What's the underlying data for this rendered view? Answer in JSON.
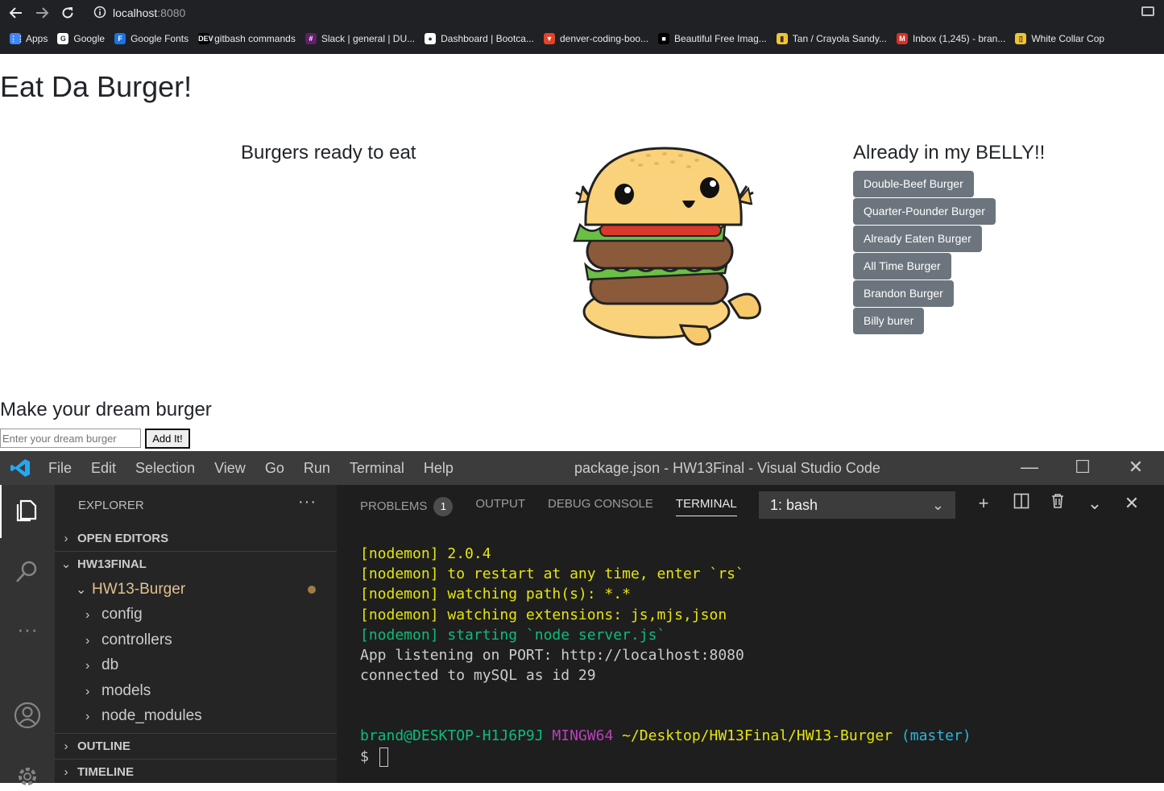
{
  "browser": {
    "url_host": "localhost",
    "url_port": ":8080",
    "bookmarks": [
      {
        "label": "Apps",
        "color": "#4285f4",
        "icon": "apps-grid-icon",
        "glyph": "⋮⋮"
      },
      {
        "label": "Google",
        "color": "#ffffff",
        "icon": "google-icon",
        "glyph": "G"
      },
      {
        "label": "Google Fonts",
        "color": "#1a73e8",
        "icon": "google-fonts-icon",
        "glyph": "F"
      },
      {
        "label": "gitbash commands",
        "color": "#000000",
        "icon": "dev-icon",
        "glyph": "DEV"
      },
      {
        "label": "Slack | general | DU...",
        "color": "#611f69",
        "icon": "slack-icon",
        "glyph": "#"
      },
      {
        "label": "Dashboard | Bootca...",
        "color": "#ffffff",
        "icon": "dashboard-icon",
        "glyph": "●"
      },
      {
        "label": "denver-coding-boo...",
        "color": "#e24329",
        "icon": "gitlab-icon",
        "glyph": "▼"
      },
      {
        "label": "Beautiful Free Imag...",
        "color": "#000000",
        "icon": "unsplash-icon",
        "glyph": "■"
      },
      {
        "label": "Tan / Crayola Sandy...",
        "color": "#f4c430",
        "icon": "crayola-icon",
        "glyph": "▮"
      },
      {
        "label": "Inbox (1,245) - bran...",
        "color": "#d93025",
        "icon": "gmail-icon",
        "glyph": "M"
      },
      {
        "label": "White Collar Cop",
        "color": "#f1c232",
        "icon": "doc-icon",
        "glyph": "▯"
      }
    ]
  },
  "page": {
    "title": "Eat Da Burger!",
    "ready_title": "Burgers ready to eat",
    "belly_title": "Already in my BELLY!!",
    "eaten_burgers": [
      "Double-Beef Burger",
      "Quarter-Pounder Burger",
      "Already Eaten Burger",
      "All Time Burger",
      "Brandon Burger",
      "Billy burer"
    ],
    "make_title": "Make your dream burger",
    "input_placeholder": "Enter your dream burger",
    "add_label": "Add It!"
  },
  "vscode": {
    "menu": [
      "File",
      "Edit",
      "Selection",
      "View",
      "Go",
      "Run",
      "Terminal",
      "Help"
    ],
    "window_title": "package.json - HW13Final - Visual Studio Code",
    "explorer_title": "EXPLORER",
    "open_editors": "OPEN EDITORS",
    "root": "HW13FINAL",
    "project_folder": "HW13-Burger",
    "folders": [
      "config",
      "controllers",
      "db",
      "models",
      "node_modules"
    ],
    "outline": "OUTLINE",
    "timeline": "TIMELINE",
    "tabs": {
      "problems": "PROBLEMS",
      "problems_count": "1",
      "output": "OUTPUT",
      "debug": "DEBUG CONSOLE",
      "terminal": "TERMINAL"
    },
    "terminal_select": "1: bash",
    "terminal_lines": [
      {
        "text": "[nodemon] 2.0.4",
        "cls": "y"
      },
      {
        "text": "[nodemon] to restart at any time, enter `rs`",
        "cls": "y"
      },
      {
        "text": "[nodemon] watching path(s): *.*",
        "cls": "y"
      },
      {
        "text": "[nodemon] watching extensions: js,mjs,json",
        "cls": "y"
      },
      {
        "text": "[nodemon] starting `node server.js`",
        "cls": "g"
      },
      {
        "text": "App listening on PORT: http://localhost:8080",
        "cls": "w"
      },
      {
        "text": "connected to mySQL as id 29",
        "cls": "w"
      }
    ],
    "prompt_user": "brand@DESKTOP-H1J6P9J",
    "prompt_shell": "MINGW64",
    "prompt_path": "~/Desktop/HW13Final/HW13-Burger",
    "prompt_branch": "(master)",
    "prompt_symbol": "$"
  }
}
